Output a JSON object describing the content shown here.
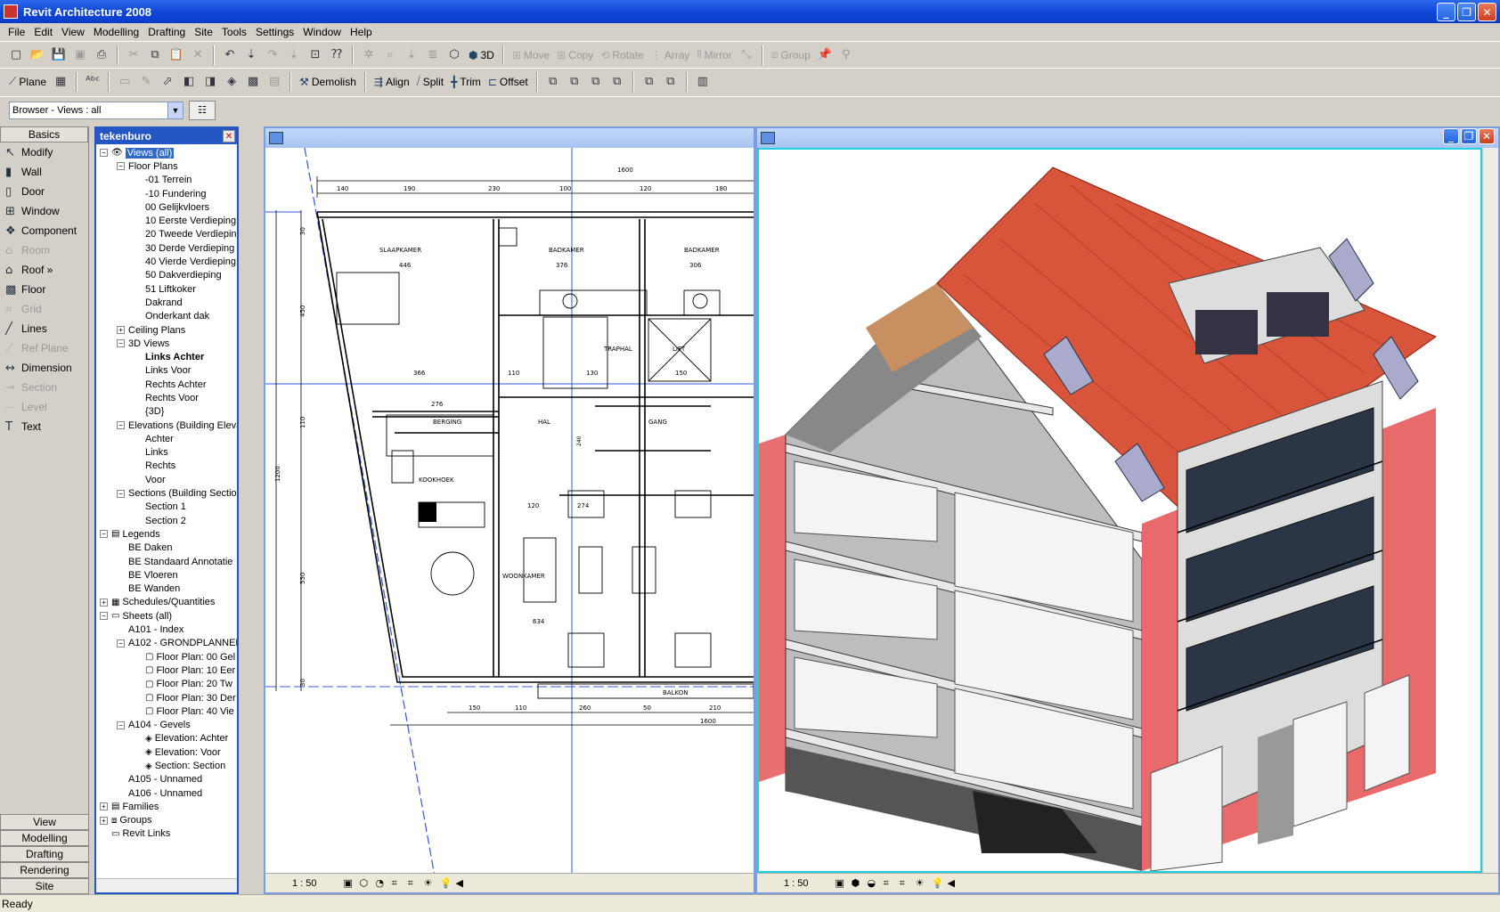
{
  "window": {
    "title": "Revit Architecture 2008"
  },
  "menu": [
    "File",
    "Edit",
    "View",
    "Modelling",
    "Drafting",
    "Site",
    "Tools",
    "Settings",
    "Window",
    "Help"
  ],
  "toolbar1": {
    "view3d": "3D",
    "move": "Move",
    "copy": "Copy",
    "rotate": "Rotate",
    "array": "Array",
    "mirror": "Mirror",
    "group": "Group"
  },
  "toolbar2": {
    "plane": "Plane",
    "demolish": "Demolish",
    "align": "Align",
    "split": "Split",
    "trim": "Trim",
    "offset": "Offset"
  },
  "browser_select": {
    "value": "Browser - Views : all"
  },
  "designbar": {
    "tabs_top": "Basics",
    "items": [
      {
        "label": "Modify",
        "icon": "arrow-icon",
        "enabled": true
      },
      {
        "label": "Wall",
        "icon": "wall-icon",
        "enabled": true
      },
      {
        "label": "Door",
        "icon": "door-icon",
        "enabled": true
      },
      {
        "label": "Window",
        "icon": "window-icon",
        "enabled": true
      },
      {
        "label": "Component",
        "icon": "component-icon",
        "enabled": true
      },
      {
        "label": "Room",
        "icon": "room-icon",
        "enabled": false
      },
      {
        "label": "Roof »",
        "icon": "roof-icon",
        "enabled": true
      },
      {
        "label": "Floor",
        "icon": "floor-icon",
        "enabled": true
      },
      {
        "label": "Grid",
        "icon": "grid-icon",
        "enabled": false
      },
      {
        "label": "Lines",
        "icon": "lines-icon",
        "enabled": true
      },
      {
        "label": "Ref Plane",
        "icon": "ref-plane-icon",
        "enabled": false
      },
      {
        "label": "Dimension",
        "icon": "dimension-icon",
        "enabled": true
      },
      {
        "label": "Section",
        "icon": "section-icon",
        "enabled": false
      },
      {
        "label": "Level",
        "icon": "level-icon",
        "enabled": false
      },
      {
        "label": "Text",
        "icon": "text-icon",
        "enabled": true
      }
    ],
    "tabs_bottom": [
      "View",
      "Modelling",
      "Drafting",
      "Rendering",
      "Site"
    ]
  },
  "project_browser": {
    "title": "tekenburo",
    "tree": [
      {
        "d": 0,
        "e": "-",
        "icon": "eye",
        "label": "Views (all)",
        "sel": true
      },
      {
        "d": 1,
        "e": "-",
        "label": "Floor Plans"
      },
      {
        "d": 2,
        "label": "-01 Terrein"
      },
      {
        "d": 2,
        "label": "-10 Fundering"
      },
      {
        "d": 2,
        "label": "00 Gelijkvloers"
      },
      {
        "d": 2,
        "label": "10 Eerste Verdieping"
      },
      {
        "d": 2,
        "label": "20 Tweede Verdiepin"
      },
      {
        "d": 2,
        "label": "30 Derde Verdieping"
      },
      {
        "d": 2,
        "label": "40 Vierde Verdieping"
      },
      {
        "d": 2,
        "label": "50 Dakverdieping"
      },
      {
        "d": 2,
        "label": "51 Liftkoker"
      },
      {
        "d": 2,
        "label": "Dakrand"
      },
      {
        "d": 2,
        "label": "Onderkant dak"
      },
      {
        "d": 1,
        "e": "+",
        "label": "Ceiling Plans"
      },
      {
        "d": 1,
        "e": "-",
        "label": "3D Views"
      },
      {
        "d": 2,
        "label": "Links Achter",
        "bold": true
      },
      {
        "d": 2,
        "label": "Links Voor"
      },
      {
        "d": 2,
        "label": "Rechts Achter"
      },
      {
        "d": 2,
        "label": "Rechts Voor"
      },
      {
        "d": 2,
        "label": "{3D}"
      },
      {
        "d": 1,
        "e": "-",
        "label": "Elevations (Building Eleva"
      },
      {
        "d": 2,
        "label": "Achter"
      },
      {
        "d": 2,
        "label": "Links"
      },
      {
        "d": 2,
        "label": "Rechts"
      },
      {
        "d": 2,
        "label": "Voor"
      },
      {
        "d": 1,
        "e": "-",
        "label": "Sections (Building Section"
      },
      {
        "d": 2,
        "label": "Section 1"
      },
      {
        "d": 2,
        "label": "Section 2"
      },
      {
        "d": 0,
        "e": "-",
        "icon": "legend",
        "label": "Legends"
      },
      {
        "d": 1,
        "label": "BE Daken"
      },
      {
        "d": 1,
        "label": "BE Standaard Annotatie"
      },
      {
        "d": 1,
        "label": "BE Vloeren"
      },
      {
        "d": 1,
        "label": "BE Wanden"
      },
      {
        "d": 0,
        "e": "+",
        "icon": "schedule",
        "label": "Schedules/Quantities"
      },
      {
        "d": 0,
        "e": "-",
        "icon": "sheet",
        "label": "Sheets (all)"
      },
      {
        "d": 1,
        "label": "A101 - Index"
      },
      {
        "d": 1,
        "e": "-",
        "label": "A102 - GRONDPLANNEN"
      },
      {
        "d": 2,
        "icon": "view",
        "label": "Floor Plan: 00 Gel"
      },
      {
        "d": 2,
        "icon": "view",
        "label": "Floor Plan: 10 Eer"
      },
      {
        "d": 2,
        "icon": "view",
        "label": "Floor Plan: 20 Tw"
      },
      {
        "d": 2,
        "icon": "view",
        "label": "Floor Plan: 30 Der"
      },
      {
        "d": 2,
        "icon": "view",
        "label": "Floor Plan: 40 Vie"
      },
      {
        "d": 1,
        "e": "-",
        "label": "A104 - Gevels"
      },
      {
        "d": 2,
        "icon": "elev",
        "label": "Elevation: Achter"
      },
      {
        "d": 2,
        "icon": "elev",
        "label": "Elevation: Voor"
      },
      {
        "d": 2,
        "icon": "elev",
        "label": "Section: Section"
      },
      {
        "d": 1,
        "label": "A105 - Unnamed"
      },
      {
        "d": 1,
        "label": "A106 - Unnamed"
      },
      {
        "d": 0,
        "e": "+",
        "icon": "family",
        "label": "Families"
      },
      {
        "d": 0,
        "e": "+",
        "icon": "group",
        "label": "Groups"
      },
      {
        "d": 0,
        "icon": "link",
        "label": "Revit Links"
      }
    ]
  },
  "plan_view": {
    "scale": "1 : 50",
    "labels": {
      "slaapkamer": "SLAAPKAMER",
      "badkamer1": "BADKAMER",
      "badkamer2": "BADKAMER",
      "traphal": "TRAPHAL",
      "lift": "LIFT",
      "berging": "BERGING",
      "hal": "HAL",
      "gang": "GANG",
      "kookhoek": "KOOKHOEK",
      "woonkamer": "WOONKAMER",
      "balkon": "BALKON",
      "d1600t": "1600",
      "d140": "140",
      "d190": "190",
      "d230": "230",
      "d100a": "100",
      "d120a": "120",
      "d180": "180",
      "d446": "446",
      "d376": "376",
      "d306": "306",
      "d366": "366",
      "d110": "110",
      "d130": "130",
      "d150": "150",
      "d276": "276",
      "d240": "240",
      "d120b": "120",
      "d274": "274",
      "d634": "634",
      "d150b": "150",
      "d110b": "110",
      "d260": "260",
      "d50": "50",
      "d210": "210",
      "d1600b": "1600",
      "dv30a": "30",
      "dv450": "450",
      "dv110": "110",
      "dv1200": "1200",
      "dv550": "550",
      "dv30b": "30"
    }
  },
  "model_view": {
    "scale": "1 : 50"
  },
  "status": {
    "text": "Ready"
  },
  "colors": {
    "roof": "#d8553c",
    "brick": "#e87070",
    "frame": "#2456c4"
  }
}
